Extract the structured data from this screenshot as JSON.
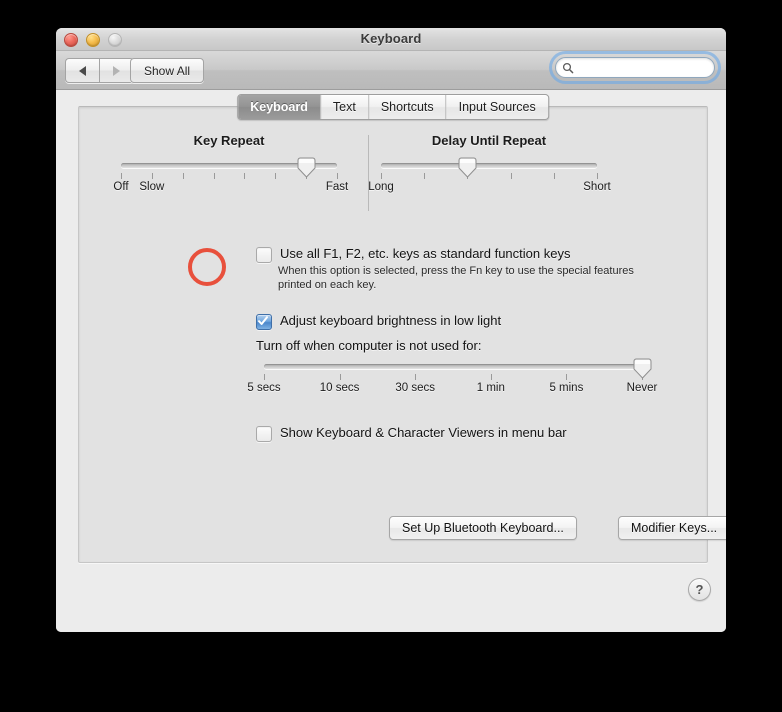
{
  "window": {
    "title": "Keyboard",
    "traffic_lights": [
      "close",
      "minimize",
      "zoom"
    ]
  },
  "toolbar": {
    "back_label": "",
    "forward_label": "",
    "show_all_label": "Show All",
    "search": {
      "value": "",
      "placeholder": "",
      "icon": "search-icon",
      "focused": true
    }
  },
  "tabs": [
    {
      "label": "Keyboard",
      "selected": true
    },
    {
      "label": "Text",
      "selected": false
    },
    {
      "label": "Shortcuts",
      "selected": false
    },
    {
      "label": "Input Sources",
      "selected": false
    }
  ],
  "key_repeat": {
    "title": "Key Repeat",
    "tick_count": 8,
    "value_index": 6,
    "labels": [
      {
        "text": "Off",
        "pos": 0
      },
      {
        "text": "Slow",
        "pos": 1
      },
      {
        "text": "Fast",
        "pos": 7
      }
    ]
  },
  "delay_until_repeat": {
    "title": "Delay Until Repeat",
    "tick_count": 6,
    "value_index": 2,
    "labels": [
      {
        "text": "Long",
        "pos": 0
      },
      {
        "text": "Short",
        "pos": 5
      }
    ]
  },
  "function_keys": {
    "label": "Use all F1, F2, etc. keys as standard function keys",
    "checked": false,
    "description": "When this option is selected, press the Fn key to use the special features printed on each key."
  },
  "brightness": {
    "label": "Adjust keyboard brightness in low light",
    "checked": true
  },
  "turn_off": {
    "label": "Turn off when computer is not used for:",
    "tick_count": 6,
    "value_index": 5,
    "labels": [
      "5 secs",
      "10 secs",
      "30 secs",
      "1 min",
      "5 mins",
      "Never"
    ]
  },
  "show_viewers": {
    "label": "Show Keyboard & Character Viewers in menu bar",
    "checked": false
  },
  "buttons": {
    "bluetooth": "Set Up Bluetooth Keyboard...",
    "modifier": "Modifier Keys...",
    "help": "?"
  },
  "annotation": {
    "color": "#e8503c",
    "target": "function-keys-checkbox"
  }
}
